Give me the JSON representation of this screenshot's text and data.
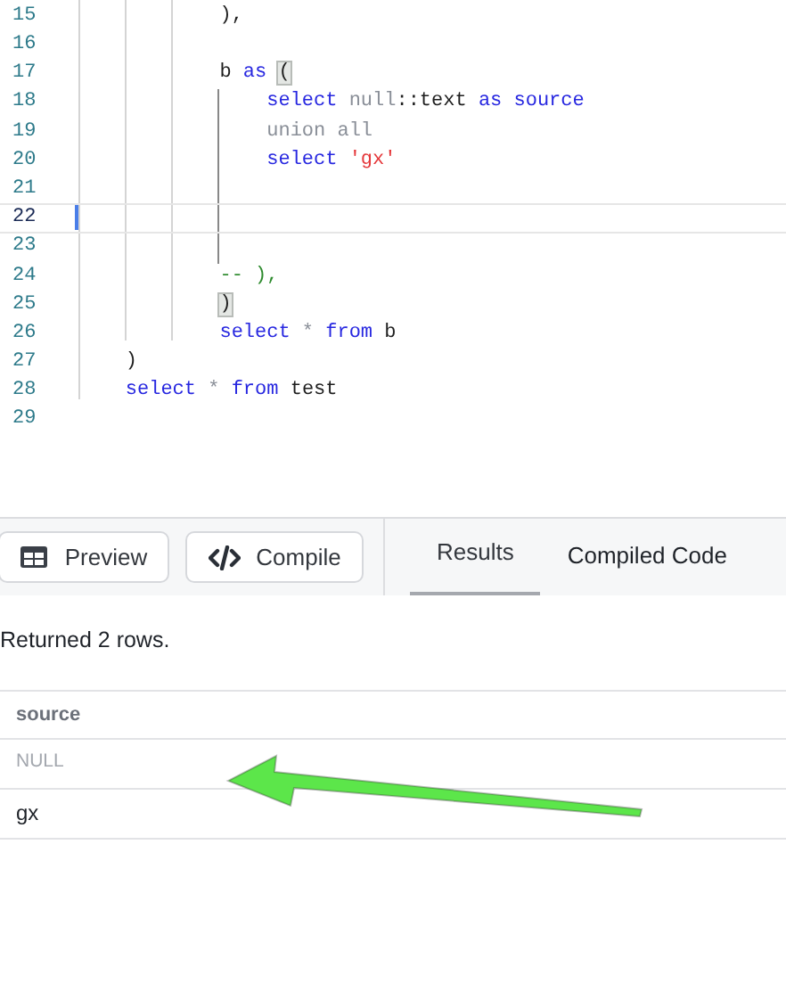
{
  "editor": {
    "lines": [
      {
        "number": "15",
        "active": false,
        "tokens": [
          {
            "kind": "text",
            "text": "            ),"
          }
        ]
      },
      {
        "number": "16",
        "active": false
      },
      {
        "number": "17",
        "active": false,
        "tokens": [
          {
            "kind": "text",
            "text": "            b "
          },
          {
            "kind": "keyword",
            "text": "as "
          },
          {
            "kind": "bracket",
            "text": "("
          }
        ]
      },
      {
        "number": "18",
        "active": false,
        "tokens": [
          {
            "kind": "keyword",
            "text": "                select "
          },
          {
            "kind": "muted",
            "text": "null"
          },
          {
            "kind": "text",
            "text": "::text "
          },
          {
            "kind": "keyword",
            "text": "as source"
          }
        ]
      },
      {
        "number": "19",
        "active": false,
        "tokens": [
          {
            "kind": "muted",
            "text": "                union all"
          }
        ]
      },
      {
        "number": "20",
        "active": false,
        "tokens": [
          {
            "kind": "keyword",
            "text": "                select "
          },
          {
            "kind": "string",
            "text": "'gx'"
          }
        ]
      },
      {
        "number": "21",
        "active": false
      },
      {
        "number": "22",
        "active": true
      },
      {
        "number": "23",
        "active": false
      },
      {
        "number": "24",
        "active": false,
        "tokens": [
          {
            "kind": "comment",
            "text": "            -- ),"
          }
        ]
      },
      {
        "number": "25",
        "active": false,
        "tokens": [
          {
            "kind": "bracket",
            "text": ")"
          }
        ]
      },
      {
        "number": "26",
        "active": false,
        "tokens": [
          {
            "kind": "keyword",
            "text": "            select "
          },
          {
            "kind": "muted",
            "text": "* "
          },
          {
            "kind": "keyword",
            "text": "from "
          },
          {
            "kind": "text",
            "text": "b"
          }
        ]
      },
      {
        "number": "27",
        "active": false,
        "tokens": [
          {
            "kind": "text",
            "text": "    )"
          }
        ]
      },
      {
        "number": "28",
        "active": false,
        "tokens": [
          {
            "kind": "keyword",
            "text": "    select "
          },
          {
            "kind": "muted",
            "text": "* "
          },
          {
            "kind": "keyword",
            "text": "from "
          },
          {
            "kind": "text",
            "text": "test"
          }
        ]
      },
      {
        "number": "29",
        "active": false
      }
    ]
  },
  "toolbar": {
    "buttons": [
      {
        "kind": "preview",
        "label": "Preview"
      },
      {
        "kind": "compile",
        "label": "Compile"
      }
    ],
    "tabs": [
      {
        "label": "Results",
        "selected": true
      },
      {
        "label": "Compiled Code",
        "selected": false
      }
    ]
  },
  "results": {
    "message": "Returned 2 rows.",
    "columns": [
      "source"
    ],
    "rows": [
      {
        "value": "NULL",
        "null": true
      },
      {
        "value": "gx",
        "null": false
      }
    ]
  }
}
